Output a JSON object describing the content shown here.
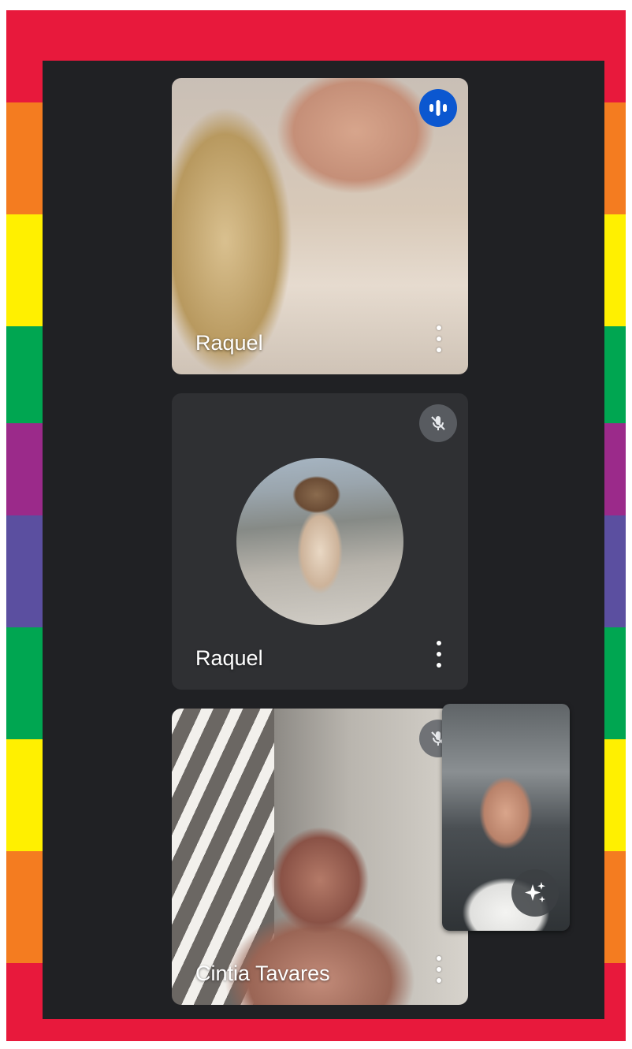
{
  "colors": {
    "frame_stripes": [
      "#e8193c",
      "#f47c20",
      "#fff000",
      "#00a651",
      "#9b2a8a",
      "#5b4fa0",
      "#00a651",
      "#fff000",
      "#f47c20",
      "#e8193c"
    ],
    "screen_background": "#202124",
    "speaking_badge": "#0b57d0"
  },
  "participants": [
    {
      "name": "Raquel",
      "status": "speaking",
      "status_icon": "audio-wave-icon",
      "has_video": true
    },
    {
      "name": "Raquel",
      "status": "muted",
      "status_icon": "mic-off-icon",
      "has_video": false
    },
    {
      "name": "Cintia Tavares",
      "status": "muted",
      "status_icon": "mic-off-icon",
      "has_video": true
    }
  ],
  "self_view": {
    "effects_icon": "sparkles-icon"
  },
  "tile_menu_icon": "more-vert-icon"
}
